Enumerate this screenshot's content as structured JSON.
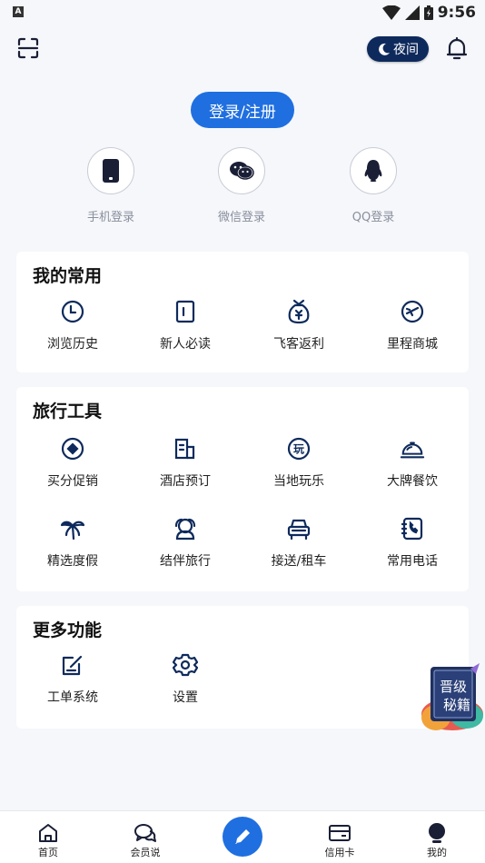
{
  "status": {
    "badge": "A",
    "time": "9:56"
  },
  "header": {
    "night_label": "夜间"
  },
  "login": {
    "button_label": "登录/注册",
    "options": [
      {
        "label": "手机登录",
        "icon": "phone-icon"
      },
      {
        "label": "微信登录",
        "icon": "wechat-icon"
      },
      {
        "label": "QQ登录",
        "icon": "qq-icon"
      }
    ]
  },
  "sections": {
    "common": {
      "title": "我的常用",
      "items": [
        {
          "label": "浏览历史",
          "icon": "clock-icon"
        },
        {
          "label": "新人必读",
          "icon": "book-icon"
        },
        {
          "label": "飞客返利",
          "icon": "money-bag-icon"
        },
        {
          "label": "里程商城",
          "icon": "plane-circle-icon"
        }
      ]
    },
    "travel": {
      "title": "旅行工具",
      "items": [
        {
          "label": "买分促销",
          "icon": "diamond-circle-icon"
        },
        {
          "label": "酒店预订",
          "icon": "hotel-icon"
        },
        {
          "label": "当地玩乐",
          "icon": "play-badge-icon",
          "glyph": "玩"
        },
        {
          "label": "大牌餐饮",
          "icon": "dining-cloche-icon"
        },
        {
          "label": "精选度假",
          "icon": "palm-tree-icon"
        },
        {
          "label": "结伴旅行",
          "icon": "companion-icon"
        },
        {
          "label": "接送/租车",
          "icon": "car-icon"
        },
        {
          "label": "常用电话",
          "icon": "phone-book-icon"
        }
      ]
    },
    "more": {
      "title": "更多功能",
      "items": [
        {
          "label": "工单系统",
          "icon": "edit-ticket-icon"
        },
        {
          "label": "设置",
          "icon": "settings-icon"
        }
      ]
    }
  },
  "promo": {
    "line1": "晋级",
    "line2": "秘籍"
  },
  "bottom_nav": [
    {
      "label": "首页",
      "icon": "home-icon"
    },
    {
      "label": "会员说",
      "icon": "chat-icon"
    },
    {
      "label": "信用卡",
      "icon": "credit-card-icon"
    },
    {
      "label": "我的",
      "icon": "profile-icon"
    }
  ],
  "colors": {
    "accent": "#1f6fe0",
    "navy": "#0e2a5c",
    "background": "#f5f7fb"
  }
}
